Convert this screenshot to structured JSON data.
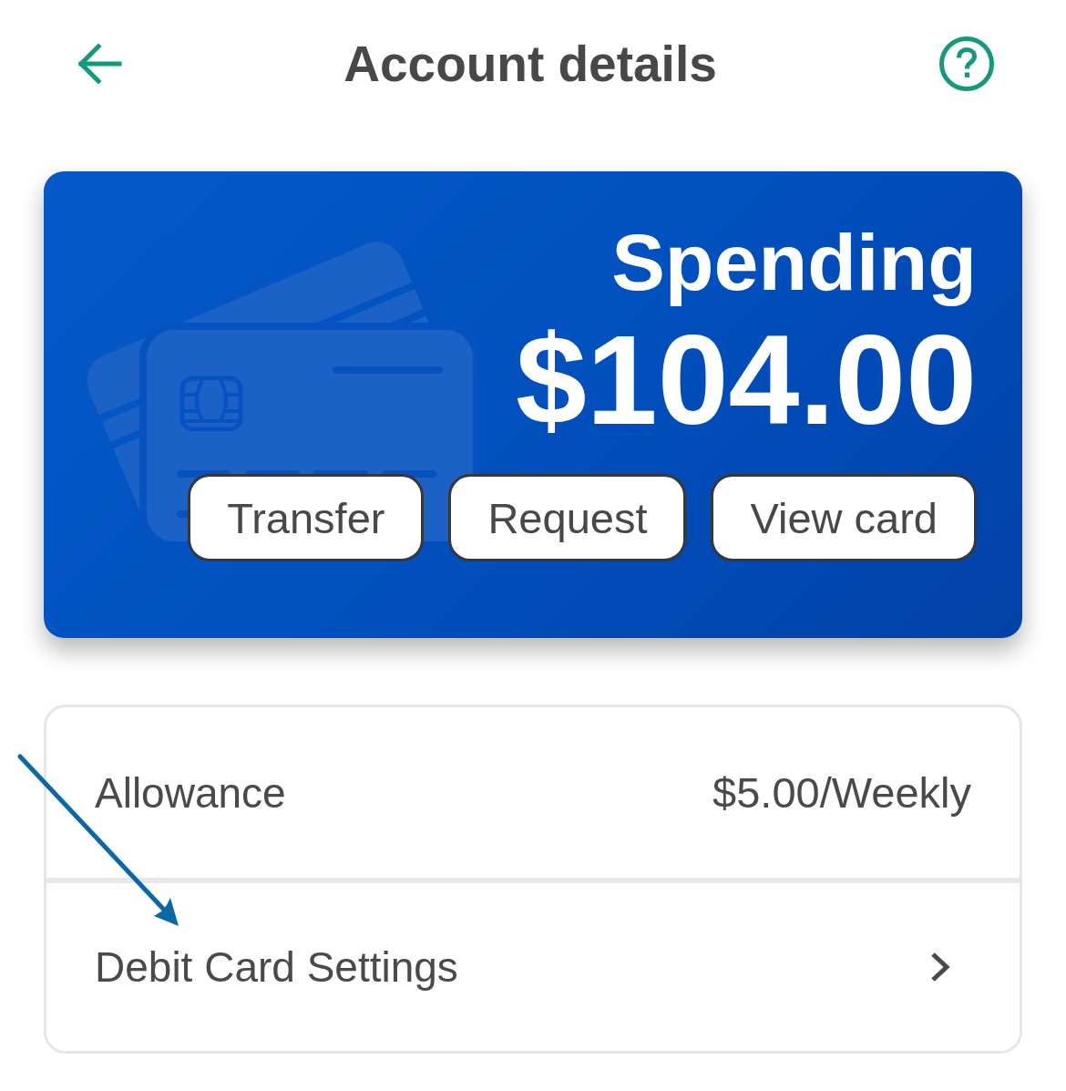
{
  "header": {
    "title": "Account details"
  },
  "account_card": {
    "name": "Spending",
    "balance": "$104.00",
    "actions": [
      "Transfer",
      "Request",
      "View card"
    ]
  },
  "details": [
    {
      "kind": "value",
      "label": "Allowance",
      "value": "$5.00/Weekly"
    },
    {
      "kind": "link",
      "label": "Debit Card Settings"
    }
  ]
}
